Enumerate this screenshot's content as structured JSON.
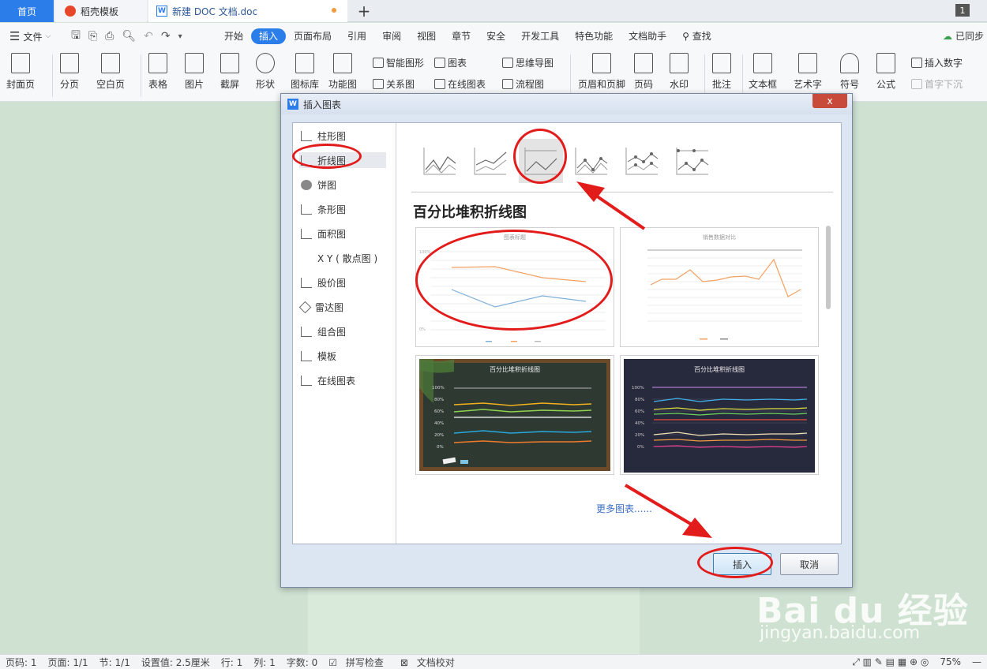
{
  "tabs": {
    "home": "首页",
    "template": "稻壳模板",
    "doc": "新建 DOC 文档.doc",
    "counter": "1"
  },
  "menu": {
    "file": "文件",
    "items": [
      "开始",
      "插入",
      "页面布局",
      "引用",
      "审阅",
      "视图",
      "章节",
      "安全",
      "开发工具",
      "特色功能",
      "文档助手"
    ],
    "active_index": 1,
    "search": "查找",
    "sync": "已同步"
  },
  "ribbon": {
    "cover": "封面页",
    "page_break": "分页",
    "blank_page": "空白页",
    "table": "表格",
    "picture": "图片",
    "screenshot": "截屏",
    "shape": "形状",
    "icon_lib": "图标库",
    "func_chart": "功能图",
    "smart_shape": "智能图形",
    "chart": "图表",
    "mind_map": "思维导图",
    "relation_chart": "关系图",
    "online_chart": "在线图表",
    "flowchart": "流程图",
    "header_footer": "页眉和页脚",
    "page_number": "页码",
    "watermark": "水印",
    "comment": "批注",
    "textbox": "文本框",
    "art_text": "艺术字",
    "symbol": "符号",
    "formula": "公式",
    "insert_number": "插入数字",
    "drop_cap": "首字下沉"
  },
  "dialog": {
    "title": "插入图表",
    "close": "x",
    "categories": [
      "柱形图",
      "折线图",
      "饼图",
      "条形图",
      "面积图",
      "X Y ( 散点图 )",
      "股价图",
      "雷达图",
      "组合图",
      "模板",
      "在线图表"
    ],
    "selected_category": 1,
    "chart_heading": "百分比堆积折线图",
    "more_charts": "更多图表......",
    "insert_button": "插入",
    "cancel_button": "取消",
    "thumbs": [
      {
        "title": "图表标题"
      },
      {
        "title": "销售数据对比"
      },
      {
        "title": "百分比堆积折线图"
      },
      {
        "title": "百分比堆积折线图"
      }
    ]
  },
  "status": {
    "page_no": "页码: 1",
    "pages": "页面: 1/1",
    "section": "节: 1/1",
    "setting": "设置值: 2.5厘米",
    "row": "行: 1",
    "col": "列: 1",
    "chars": "字数: 0",
    "spell": "拼写检查",
    "proof": "文档校对",
    "zoom": "75%"
  },
  "watermark": {
    "brand": "Bai du 经验",
    "url": "jingyan.baidu.com"
  }
}
